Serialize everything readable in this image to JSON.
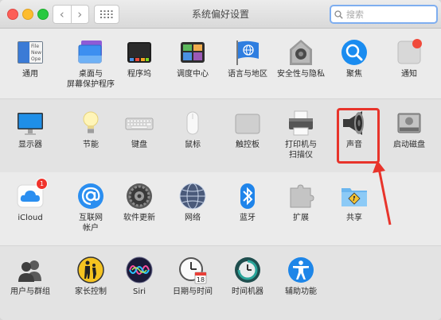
{
  "window": {
    "title": "系统偏好设置",
    "search_placeholder": "搜索",
    "back_glyph": "‹",
    "forward_glyph": "›"
  },
  "rows": [
    {
      "panes": [
        {
          "id": "general",
          "label": "通用",
          "icon": "general-icon"
        },
        {
          "id": "desktop-screensaver",
          "label": "桌面与\n屏幕保护程序",
          "icon": "desktop-screensaver-icon"
        },
        {
          "id": "dock",
          "label": "程序坞",
          "icon": "dock-icon"
        },
        {
          "id": "mission-control",
          "label": "调度中心",
          "icon": "mission-control-icon"
        },
        {
          "id": "language-region",
          "label": "语言与地区",
          "icon": "language-region-icon"
        },
        {
          "id": "security-privacy",
          "label": "安全性与隐私",
          "icon": "security-privacy-icon"
        },
        {
          "id": "spotlight",
          "label": "聚焦",
          "icon": "spotlight-icon"
        },
        {
          "id": "notifications",
          "label": "通知",
          "icon": "notifications-icon"
        }
      ]
    },
    {
      "panes": [
        {
          "id": "displays",
          "label": "显示器",
          "icon": "displays-icon"
        },
        {
          "id": "energy-saver",
          "label": "节能",
          "icon": "energy-saver-icon"
        },
        {
          "id": "keyboard",
          "label": "键盘",
          "icon": "keyboard-icon"
        },
        {
          "id": "mouse",
          "label": "鼠标",
          "icon": "mouse-icon"
        },
        {
          "id": "trackpad",
          "label": "触控板",
          "icon": "trackpad-icon"
        },
        {
          "id": "printers-scanners",
          "label": "打印机与\n扫描仪",
          "icon": "printer-icon"
        },
        {
          "id": "sound",
          "label": "声音",
          "icon": "speaker-icon"
        },
        {
          "id": "startup-disk",
          "label": "启动磁盘",
          "icon": "startup-disk-icon"
        }
      ]
    },
    {
      "panes": [
        {
          "id": "icloud",
          "label": "iCloud",
          "icon": "icloud-icon",
          "badge": "1"
        },
        {
          "id": "internet-accounts",
          "label": "互联网\n帐户",
          "icon": "internet-accounts-icon"
        },
        {
          "id": "software-update",
          "label": "软件更新",
          "icon": "software-update-icon"
        },
        {
          "id": "network",
          "label": "网络",
          "icon": "network-icon"
        },
        {
          "id": "bluetooth",
          "label": "蓝牙",
          "icon": "bluetooth-icon"
        },
        {
          "id": "extensions",
          "label": "扩展",
          "icon": "extensions-icon"
        },
        {
          "id": "sharing",
          "label": "共享",
          "icon": "sharing-icon"
        }
      ]
    },
    {
      "panes": [
        {
          "id": "users-groups",
          "label": "用户与群组",
          "icon": "users-groups-icon"
        },
        {
          "id": "parental-controls",
          "label": "家长控制",
          "icon": "parental-controls-icon"
        },
        {
          "id": "siri",
          "label": "Siri",
          "icon": "siri-icon"
        },
        {
          "id": "date-time",
          "label": "日期与时间",
          "icon": "date-time-icon"
        },
        {
          "id": "time-machine",
          "label": "时间机器",
          "icon": "time-machine-icon"
        },
        {
          "id": "accessibility",
          "label": "辅助功能",
          "icon": "accessibility-icon"
        }
      ]
    }
  ],
  "calendar_day": "18",
  "general_icon_lines": [
    "File",
    "New",
    "Ope"
  ],
  "annotation": {
    "color": "#e8342b",
    "target": "sound"
  }
}
